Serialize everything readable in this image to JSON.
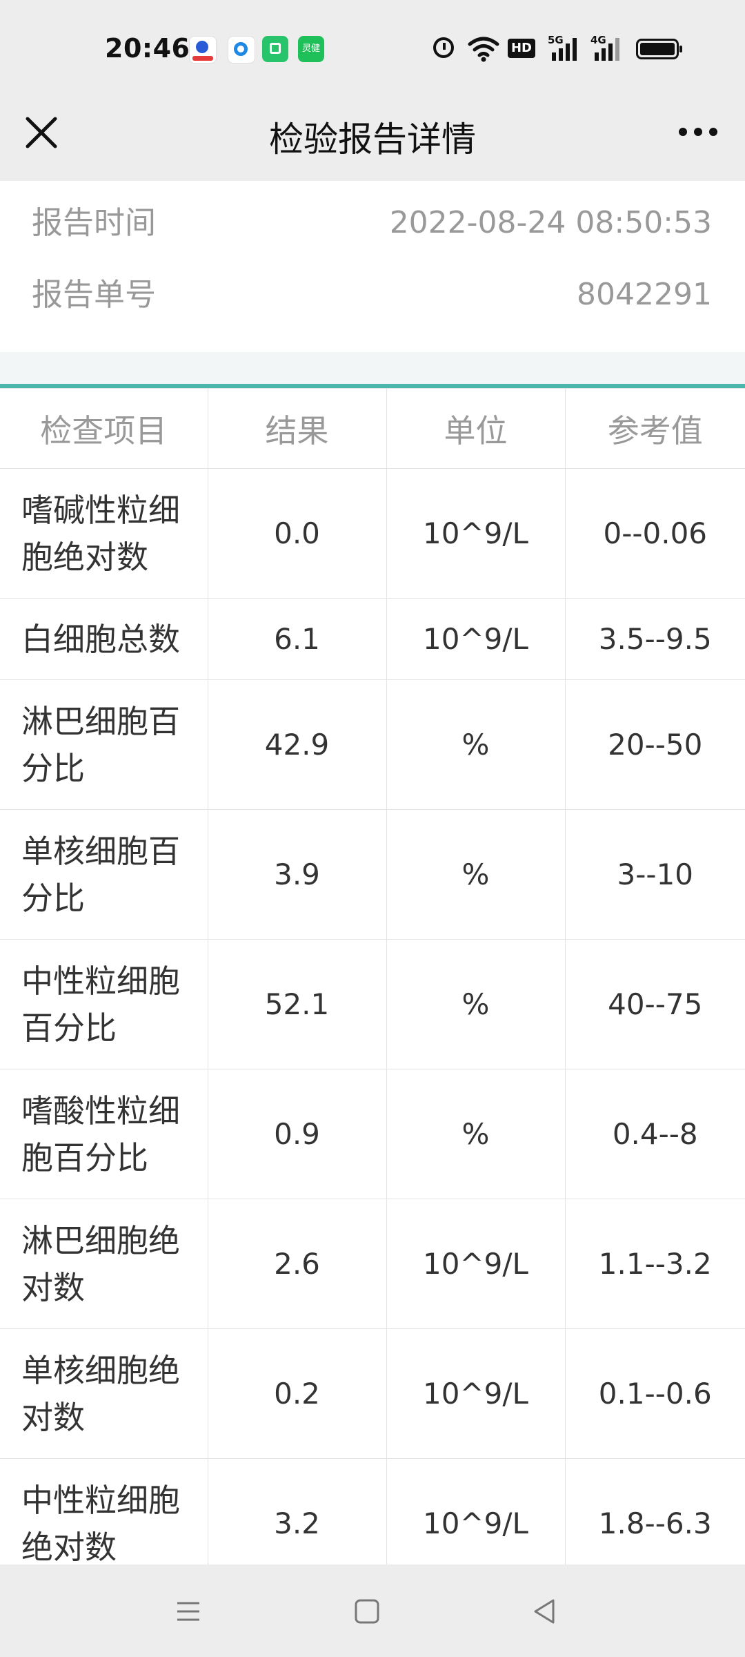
{
  "status_bar": {
    "time": "20:46",
    "app_icon_text": "灵健",
    "hd_label": "HD",
    "signal_5g": "5G",
    "signal_4g": "4G",
    "icons": [
      "baidu-app-icon",
      "blue-app-icon",
      "green-app-icon",
      "lingjian-app-icon",
      "alarm-icon",
      "wifi-icon",
      "hd-icon",
      "signal-5g-icon",
      "signal-4g-icon",
      "battery-icon"
    ]
  },
  "header": {
    "title": "检验报告详情",
    "close_icon": "close-icon",
    "more_icon": "more-icon"
  },
  "info": {
    "report_time_label": "报告时间",
    "report_time_value": "2022-08-24 08:50:53",
    "report_no_label": "报告单号",
    "report_no_value": "8042291"
  },
  "table": {
    "headers": [
      "检查项目",
      "结果",
      "单位",
      "参考值"
    ],
    "rows": [
      {
        "name": "嗜碱性粒细胞绝对数",
        "result": "0.0",
        "unit": "10^9/L",
        "reference": "0--0.06"
      },
      {
        "name": "白细胞总数",
        "result": "6.1",
        "unit": "10^9/L",
        "reference": "3.5--9.5"
      },
      {
        "name": "淋巴细胞百分比",
        "result": "42.9",
        "unit": "%",
        "reference": "20--50"
      },
      {
        "name": "单核细胞百分比",
        "result": "3.9",
        "unit": "%",
        "reference": "3--10"
      },
      {
        "name": "中性粒细胞百分比",
        "result": "52.1",
        "unit": "%",
        "reference": "40--75"
      },
      {
        "name": "嗜酸性粒细胞百分比",
        "result": "0.9",
        "unit": "%",
        "reference": "0.4--8"
      },
      {
        "name": "淋巴细胞绝对数",
        "result": "2.6",
        "unit": "10^9/L",
        "reference": "1.1--3.2"
      },
      {
        "name": "单核细胞绝对数",
        "result": "0.2",
        "unit": "10^9/L",
        "reference": "0.1--0.6"
      },
      {
        "name": "中性粒细胞绝对数",
        "result": "3.2",
        "unit": "10^9/L",
        "reference": "1.8--6.3"
      }
    ]
  },
  "nav_bar": {
    "icons": [
      "menu-icon",
      "home-icon",
      "back-icon"
    ]
  },
  "colors": {
    "accent_line": "#4db6ac",
    "header_bg": "#ededed",
    "label_gray": "#999999",
    "text_dark": "#333333"
  }
}
